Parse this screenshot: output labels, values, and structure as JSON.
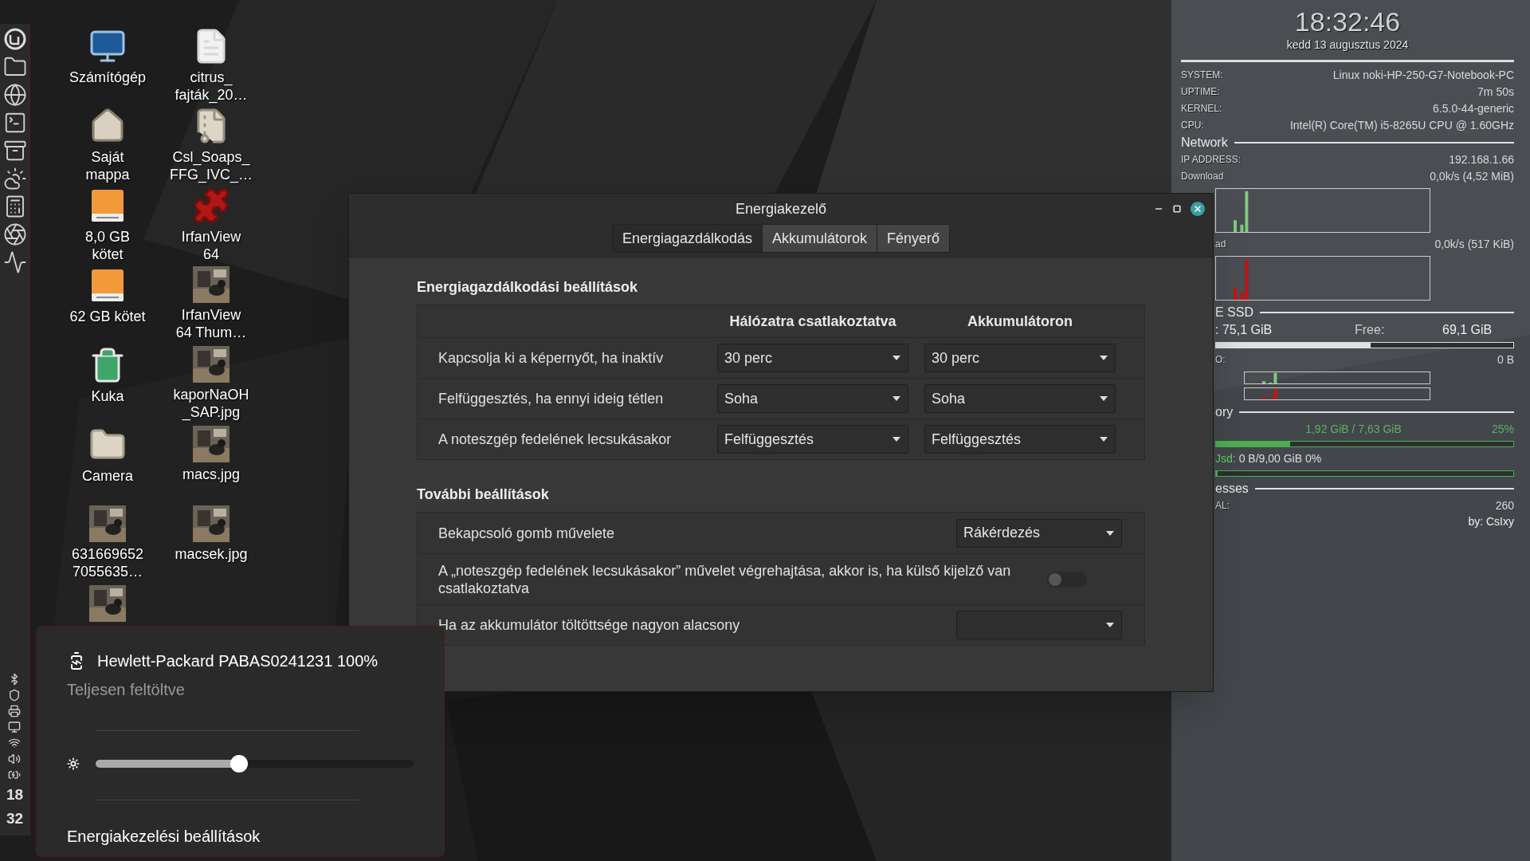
{
  "panel": {
    "clock": [
      "18",
      "32"
    ]
  },
  "desktop_icons": [
    {
      "kind": "computer",
      "lines": [
        "Számítógép"
      ]
    },
    {
      "kind": "document",
      "lines": [
        "citrus_",
        "fajták_20…"
      ]
    },
    {
      "kind": "home-folder",
      "lines": [
        "Saját",
        "mappa"
      ]
    },
    {
      "kind": "archive",
      "lines": [
        "Csl_Soaps_",
        "FFG_IVC_…"
      ]
    },
    {
      "kind": "drive",
      "lines": [
        "8,0 GB",
        "kötet"
      ]
    },
    {
      "kind": "puzzle",
      "lines": [
        "IrfanView",
        "64"
      ]
    },
    {
      "kind": "drive",
      "lines": [
        "62 GB kötet"
      ]
    },
    {
      "kind": "picture",
      "lines": [
        "IrfanView",
        "64 Thum…"
      ]
    },
    {
      "kind": "trash",
      "lines": [
        "Kuka"
      ]
    },
    {
      "kind": "picture",
      "lines": [
        "kaporNaOH",
        "_SAP.jpg"
      ]
    },
    {
      "kind": "folder",
      "lines": [
        "Camera"
      ]
    },
    {
      "kind": "picture",
      "lines": [
        "macs.jpg"
      ]
    },
    {
      "kind": "picture",
      "lines": [
        "631669652",
        "7055635…"
      ]
    },
    {
      "kind": "picture",
      "lines": [
        "macsek.jpg"
      ]
    },
    {
      "kind": "picture"
    }
  ],
  "conky": {
    "clock": "18:32:46",
    "date": "kedd 13 augusztus 2024",
    "top_rows": [
      {
        "kind": "row",
        "label": "SYSTEM:",
        "value": "Linux noki-HP-250-G7-Notebook-PC"
      },
      {
        "kind": "row",
        "label": "UPTIME:",
        "value": "7m 50s"
      },
      {
        "kind": "row",
        "label": "KERNEL:",
        "value": "6.5.0-44-generic"
      },
      {
        "kind": "row",
        "label": "CPU:",
        "value": "Intel(R) Core(TM) i5-8265U CPU @ 1.60GHz"
      },
      {
        "kind": "heading",
        "label": "Network"
      },
      {
        "kind": "row",
        "label": "IP ADDRESS:",
        "value": "192.168.1.66"
      },
      {
        "kind": "row",
        "label": "Download",
        "value": "0,0k/s (4,52 MiB)"
      }
    ],
    "lower_rows": [
      {
        "kind": "graph",
        "color": "#7fc97f"
      },
      {
        "kind": "row",
        "label": "ad",
        "value": "0,0k/s (517 KiB)"
      },
      {
        "kind": "graph",
        "color": "#cc1111"
      },
      {
        "kind": "heading",
        "label": "E SSD"
      },
      {
        "kind": "disk",
        "label": ": 75,1 GiB",
        "free_label": "Free:",
        "free_value": "69,1 GiB"
      },
      {
        "kind": "bar",
        "level": 0.52,
        "color": "#e0e0e0"
      },
      {
        "kind": "row",
        "label": "O:",
        "value": "0 B"
      },
      {
        "kind": "dual-graph"
      },
      {
        "kind": "heading",
        "label": "ory"
      },
      {
        "kind": "memory",
        "value": "1,92 GiB / 7,63 GiB",
        "percent": "25%"
      },
      {
        "kind": "bar",
        "level": 0.25,
        "color": "#4caf50"
      },
      {
        "kind": "swap",
        "label": "Jsd:",
        "value": "0 B/9,00 GiB 0%"
      },
      {
        "kind": "bar",
        "level": 0,
        "color": "#4caf50"
      },
      {
        "kind": "heading",
        "label": "esses"
      },
      {
        "kind": "row",
        "label": "AL:",
        "value": "260"
      },
      {
        "kind": "footer",
        "label": "by: CsIxy"
      }
    ]
  },
  "window": {
    "title": "Energiakezelő",
    "tabs": [
      {
        "label": "Energiagazdálkodás",
        "selected": true
      },
      {
        "label": "Akkumulátorok",
        "selected": false
      },
      {
        "label": "Fényerő",
        "selected": false
      }
    ],
    "power_section": {
      "title": "Energiagazdálkodási beállítások",
      "columns": [
        "Hálózatra csatlakoztatva",
        "Akkumulátoron"
      ],
      "rows": [
        {
          "label": "Kapcsolja ki a képernyőt, ha inaktív",
          "plugged": "30 perc",
          "battery": "30 perc"
        },
        {
          "label": "Felfüggesztés, ha ennyi ideig tétlen",
          "plugged": "Soha",
          "battery": "Soha"
        },
        {
          "label": "A noteszgép fedelének lecsukásakor",
          "plugged": "Felfüggesztés",
          "battery": "Felfüggesztés"
        }
      ]
    },
    "more_section": {
      "title": "További beállítások",
      "rows": [
        {
          "kind": "dropdown",
          "label": "Bekapcsoló gomb művelete",
          "value": "Rákérdezés"
        },
        {
          "kind": "switch",
          "label": "A „noteszgép fedelének lecsukásakor” művelet végrehajtása, akkor is, ha külső kijelző van csatlakoztatva",
          "on": false
        },
        {
          "kind": "dropdown",
          "label": "Ha az akkumulátor töltöttsége nagyon alacsony"
        }
      ]
    }
  },
  "battery_popup": {
    "title": "Hewlett-Packard PABAS0241231 100%",
    "status": "Teljesen feltöltve",
    "brightness": {
      "level": 0.45
    },
    "link": "Energiakezelési beállítások"
  }
}
